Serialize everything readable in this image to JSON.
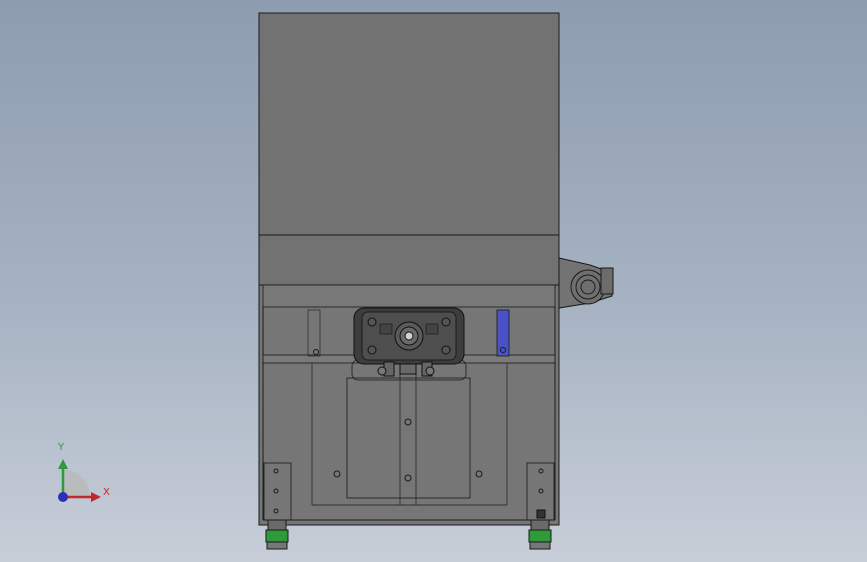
{
  "viewport": {
    "background_top": "#8d9cb0",
    "background_bottom": "#c7ced8"
  },
  "model": {
    "body_color": "#727272",
    "edge_color": "#1a1a1a",
    "bracket_color": "#4a52c6",
    "foot_color": "#2f9a3a"
  },
  "triad": {
    "x_label": "X",
    "y_label": "Y",
    "x_color": "#c0282d",
    "y_color": "#2e9a3d",
    "z_color": "#2d2fb8"
  }
}
